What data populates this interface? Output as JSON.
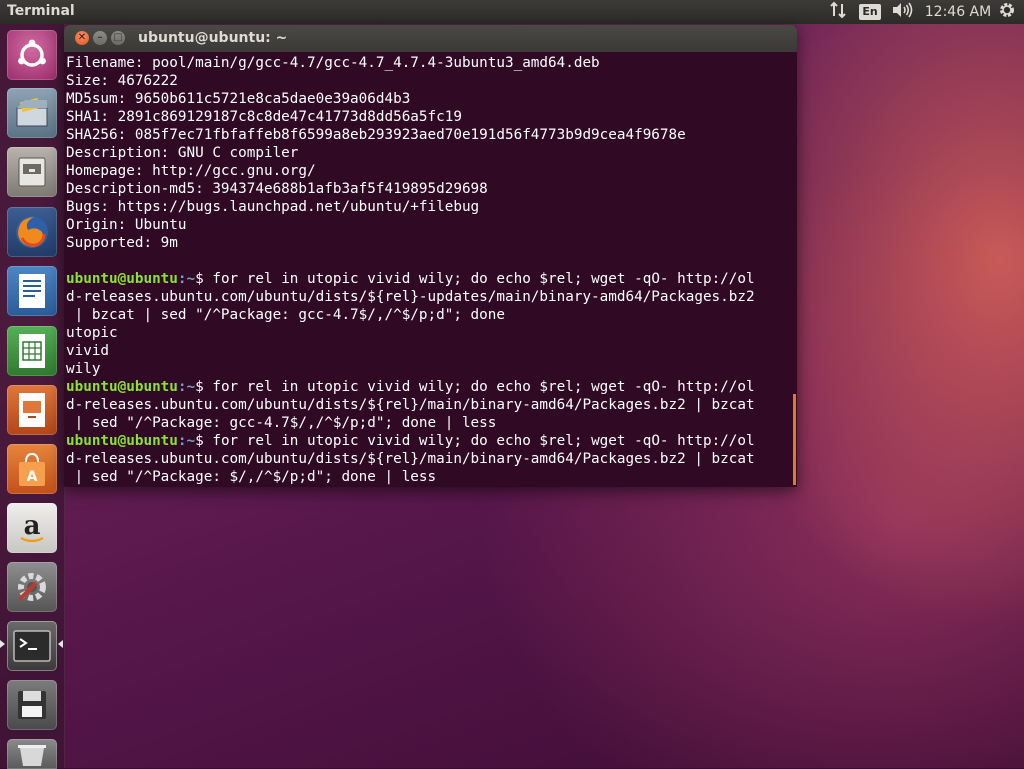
{
  "top_panel": {
    "app_title": "Terminal",
    "keyboard_layout": "En",
    "clock": "12:46 AM"
  },
  "launcher": {
    "items": [
      {
        "name": "Dash home"
      },
      {
        "name": "Files archive"
      },
      {
        "name": "Files"
      },
      {
        "name": "Firefox Web Browser"
      },
      {
        "name": "LibreOffice Writer"
      },
      {
        "name": "LibreOffice Calc"
      },
      {
        "name": "LibreOffice Impress"
      },
      {
        "name": "Ubuntu Software"
      },
      {
        "name": "Amazon"
      },
      {
        "name": "System Settings"
      },
      {
        "name": "Terminal",
        "active": true
      },
      {
        "name": "Save"
      },
      {
        "name": "Trash"
      }
    ]
  },
  "window": {
    "title": "ubuntu@ubuntu: ~",
    "prompt_user": "ubuntu@ubuntu",
    "prompt_path": ":~",
    "lines": [
      {
        "text": "Filename: pool/main/g/gcc-4.7/gcc-4.7_4.7.4-3ubuntu3_amd64.deb"
      },
      {
        "text": "Size: 4676222"
      },
      {
        "text": "MD5sum: 9650b611c5721e8ca5dae0e39a06d4b3"
      },
      {
        "text": "SHA1: 2891c869129187c8c8de47c41773d8dd56a5fc19"
      },
      {
        "text": "SHA256: 085f7ec71fbfaffeb8f6599a8eb293923aed70e191d56f4773b9d9cea4f9678e"
      },
      {
        "text": "Description: GNU C compiler"
      },
      {
        "text": "Homepage: http://gcc.gnu.org/"
      },
      {
        "text": "Description-md5: 394374e688b1afb3af5f419895d29698"
      },
      {
        "text": "Bugs: https://bugs.launchpad.net/ubuntu/+filebug"
      },
      {
        "text": "Origin: Ubuntu"
      },
      {
        "text": "Supported: 9m"
      },
      {
        "text": ""
      },
      {
        "prompt": true,
        "text": "$ for rel in utopic vivid wily; do echo $rel; wget -qO- http://ol"
      },
      {
        "text": "d-releases.ubuntu.com/ubuntu/dists/${rel}-updates/main/binary-amd64/Packages.bz2"
      },
      {
        "text": " | bzcat | sed \"/^Package: gcc-4.7$/,/^$/p;d\"; done"
      },
      {
        "text": "utopic"
      },
      {
        "text": "vivid"
      },
      {
        "text": "wily"
      },
      {
        "prompt": true,
        "text": "$ for rel in utopic vivid wily; do echo $rel; wget -qO- http://ol"
      },
      {
        "text": "d-releases.ubuntu.com/ubuntu/dists/${rel}/main/binary-amd64/Packages.bz2 | bzcat"
      },
      {
        "text": " | sed \"/^Package: gcc-4.7$/,/^$/p;d\"; done | less"
      },
      {
        "prompt": true,
        "text": "$ for rel in utopic vivid wily; do echo $rel; wget -qO- http://ol"
      },
      {
        "text": "d-releases.ubuntu.com/ubuntu/dists/${rel}/main/binary-amd64/Packages.bz2 | bzcat"
      },
      {
        "text": " | sed \"/^Package: $/,/^$/p;d\"; done | less"
      }
    ]
  },
  "colors": {
    "terminal_bg": "#300a24",
    "prompt_user": "#8ae234",
    "prompt_path": "#729fcf",
    "close_button": "#e4541c",
    "scroll_marker": "#e07a2a"
  }
}
